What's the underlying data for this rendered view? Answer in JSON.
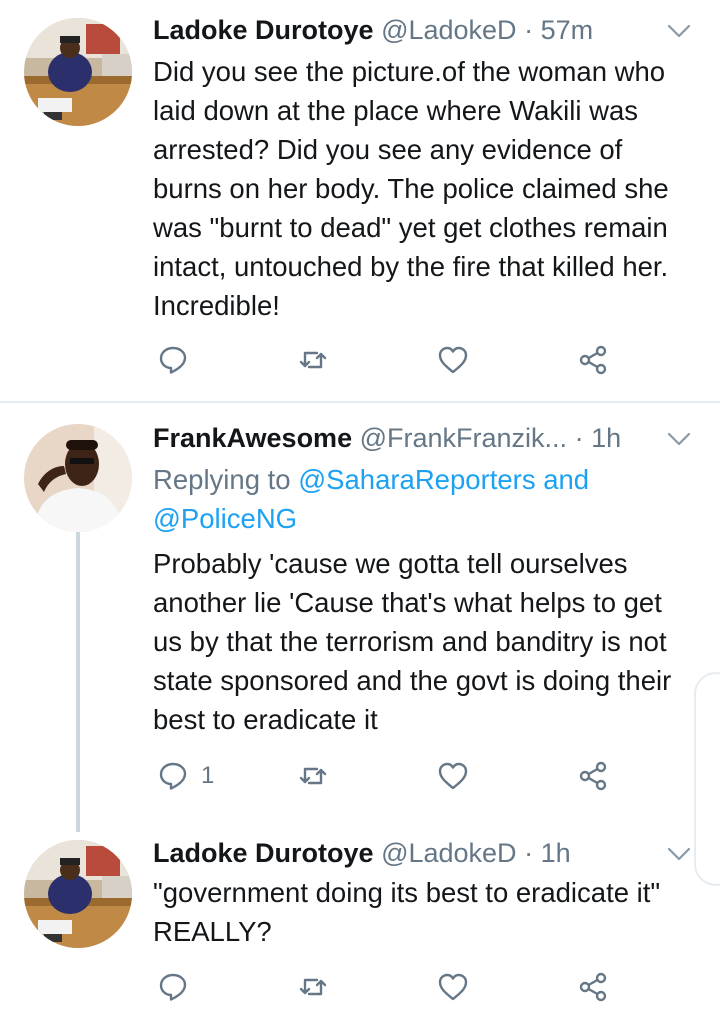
{
  "tweets": [
    {
      "name": "Ladoke Durotoye",
      "handle": "@LadokeD",
      "separator": "·",
      "time": "57m",
      "text": "Did you see the picture.of the woman who laid down at the place where Wakili was arrested? Did you see any evidence of burns on her body. The police claimed she was \"burnt to dead\" yet get clothes remain intact, untouched by the fire that killed her. Incredible!",
      "reply_count": "",
      "icons": {
        "reply": "reply-icon",
        "retweet": "retweet-icon",
        "like": "like-icon",
        "share": "share-icon",
        "menu": "chevron-down-icon"
      }
    },
    {
      "name": "FrankAwesome",
      "handle": "@FrankFranzik...",
      "separator": "·",
      "time": "1h",
      "replying_prefix": "Replying to",
      "replying_first": "@SaharaReporters",
      "replying_and": "and",
      "replying_second": "@PoliceNG",
      "text": "Probably 'cause we gotta tell ourselves another lie 'Cause that's what helps to get us by that the terrorism and banditry is not state sponsored and the govt is doing their best to eradicate it",
      "reply_count": "1"
    },
    {
      "name": "Ladoke Durotoye",
      "handle": "@LadokeD",
      "separator": "·",
      "time": "1h",
      "text": "\"government doing its best to eradicate it\" REALLY?",
      "reply_count": ""
    }
  ],
  "colors": {
    "text": "#14171a",
    "secondary": "#657786",
    "link": "#1da1f2",
    "divider": "#e6ecf0"
  }
}
